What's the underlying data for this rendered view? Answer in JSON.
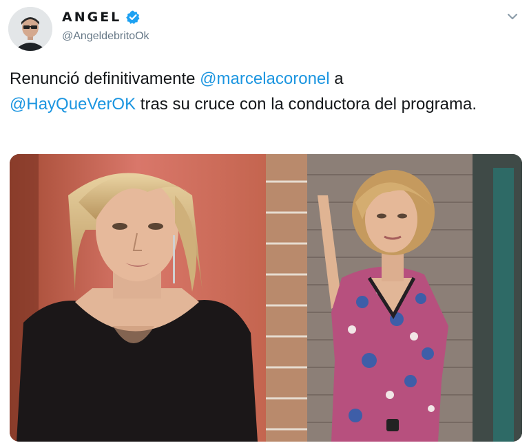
{
  "tweet": {
    "display_name": "ANGEL",
    "handle": "@AngeldebritoOk",
    "text_parts": {
      "p1": "Renunció definitivamente ",
      "mention1": "@marcelacoronel",
      "p2": " a ",
      "mention2": "@HayQueVerOK",
      "p3": " tras su cruce con la conductora del programa."
    }
  },
  "icons": {
    "verified": "verified-badge-icon",
    "menu": "chevron-down-icon"
  },
  "colors": {
    "mention": "#1b95e0",
    "verified": "#1da1f2",
    "handle": "#657786"
  }
}
